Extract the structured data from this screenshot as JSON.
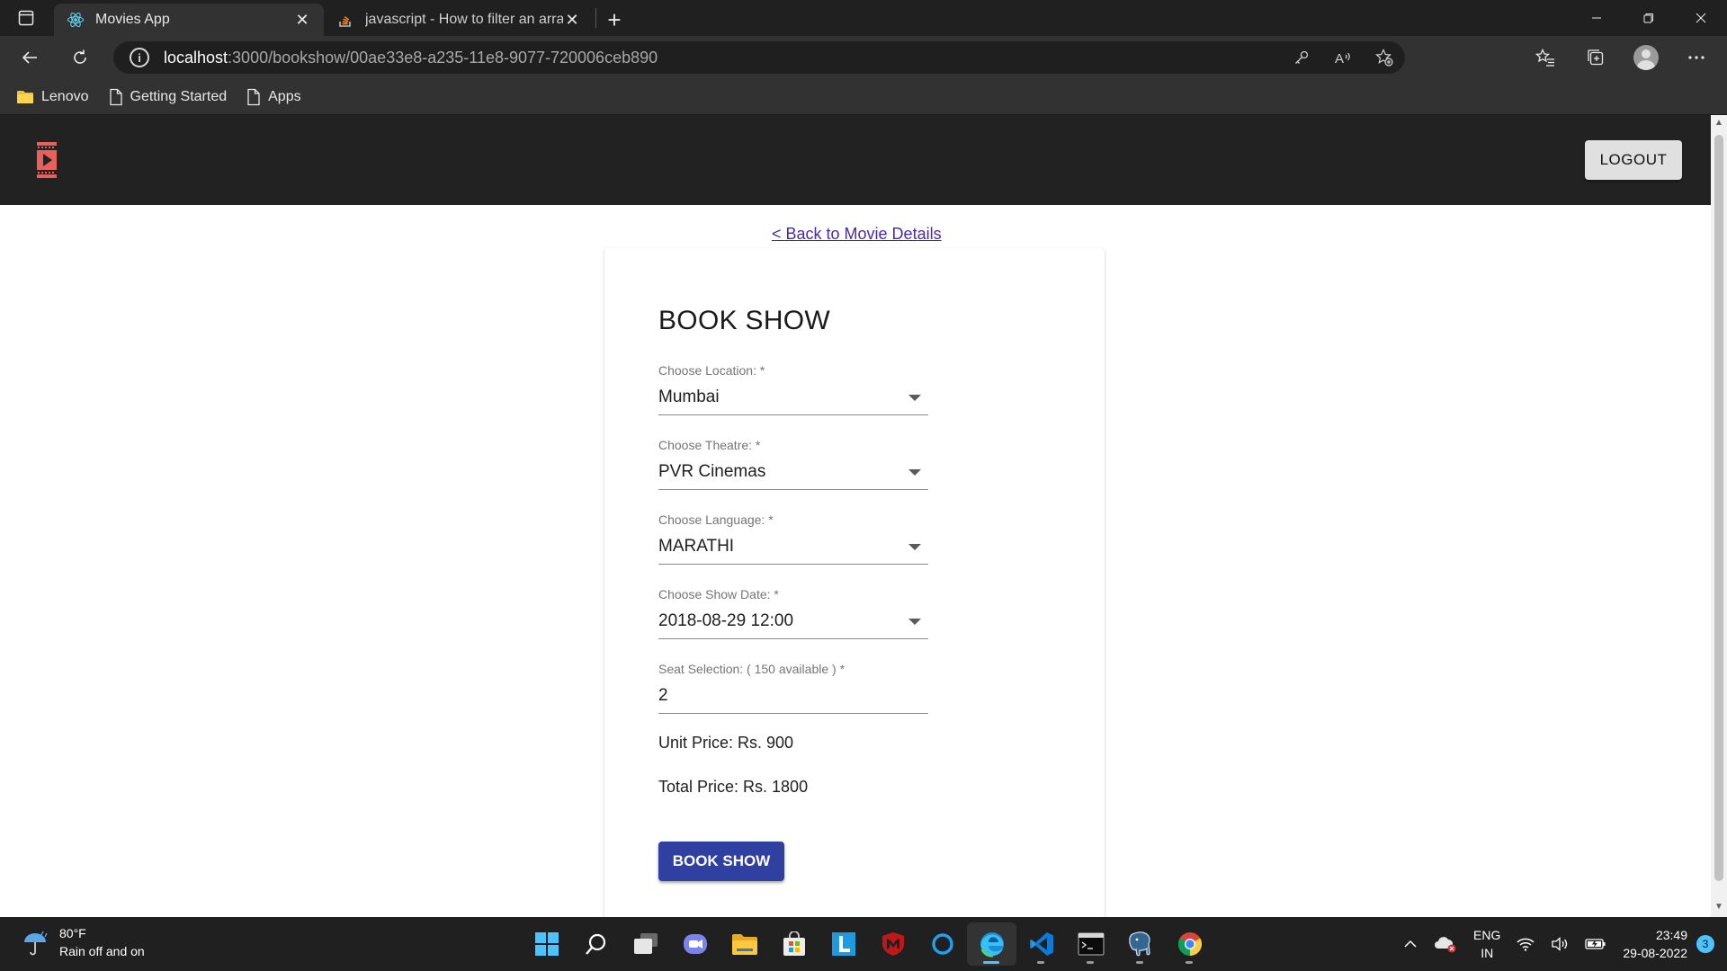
{
  "browser": {
    "tabs": [
      {
        "title": "Movies App",
        "active": true
      },
      {
        "title": "javascript - How to filter an array",
        "active": false
      }
    ],
    "url_host": "localhost",
    "url_path": ":3000/bookshow/00ae33e8-a235-11e8-9077-720006ceb890",
    "bookmarks": [
      "Lenovo",
      "Getting Started",
      "Apps"
    ]
  },
  "app": {
    "logout_label": "LOGOUT",
    "back_link": "< Back to Movie Details",
    "card_title": "BOOK SHOW",
    "fields": {
      "location": {
        "label": "Choose Location: *",
        "value": "Mumbai"
      },
      "theatre": {
        "label": "Choose Theatre: *",
        "value": "PVR Cinemas"
      },
      "language": {
        "label": "Choose Language: *",
        "value": "MARATHI"
      },
      "show_date": {
        "label": "Choose Show Date: *",
        "value": "2018-08-29 12:00"
      },
      "seats": {
        "label": "Seat Selection: ( 150 available ) *",
        "value": "2"
      }
    },
    "unit_price": "Unit Price: Rs. 900",
    "total_price": "Total Price: Rs. 1800",
    "book_button": "BOOK SHOW"
  },
  "taskbar": {
    "weather_temp": "80°F",
    "weather_desc": "Rain off and on",
    "lang_line1": "ENG",
    "lang_line2": "IN",
    "time": "23:49",
    "date": "29-08-2022",
    "notifications": "3"
  },
  "colors": {
    "primary_button": "#3040a0",
    "header_bg": "#222222",
    "logo_accent": "#e8605a",
    "link": "#4a2aa8"
  }
}
